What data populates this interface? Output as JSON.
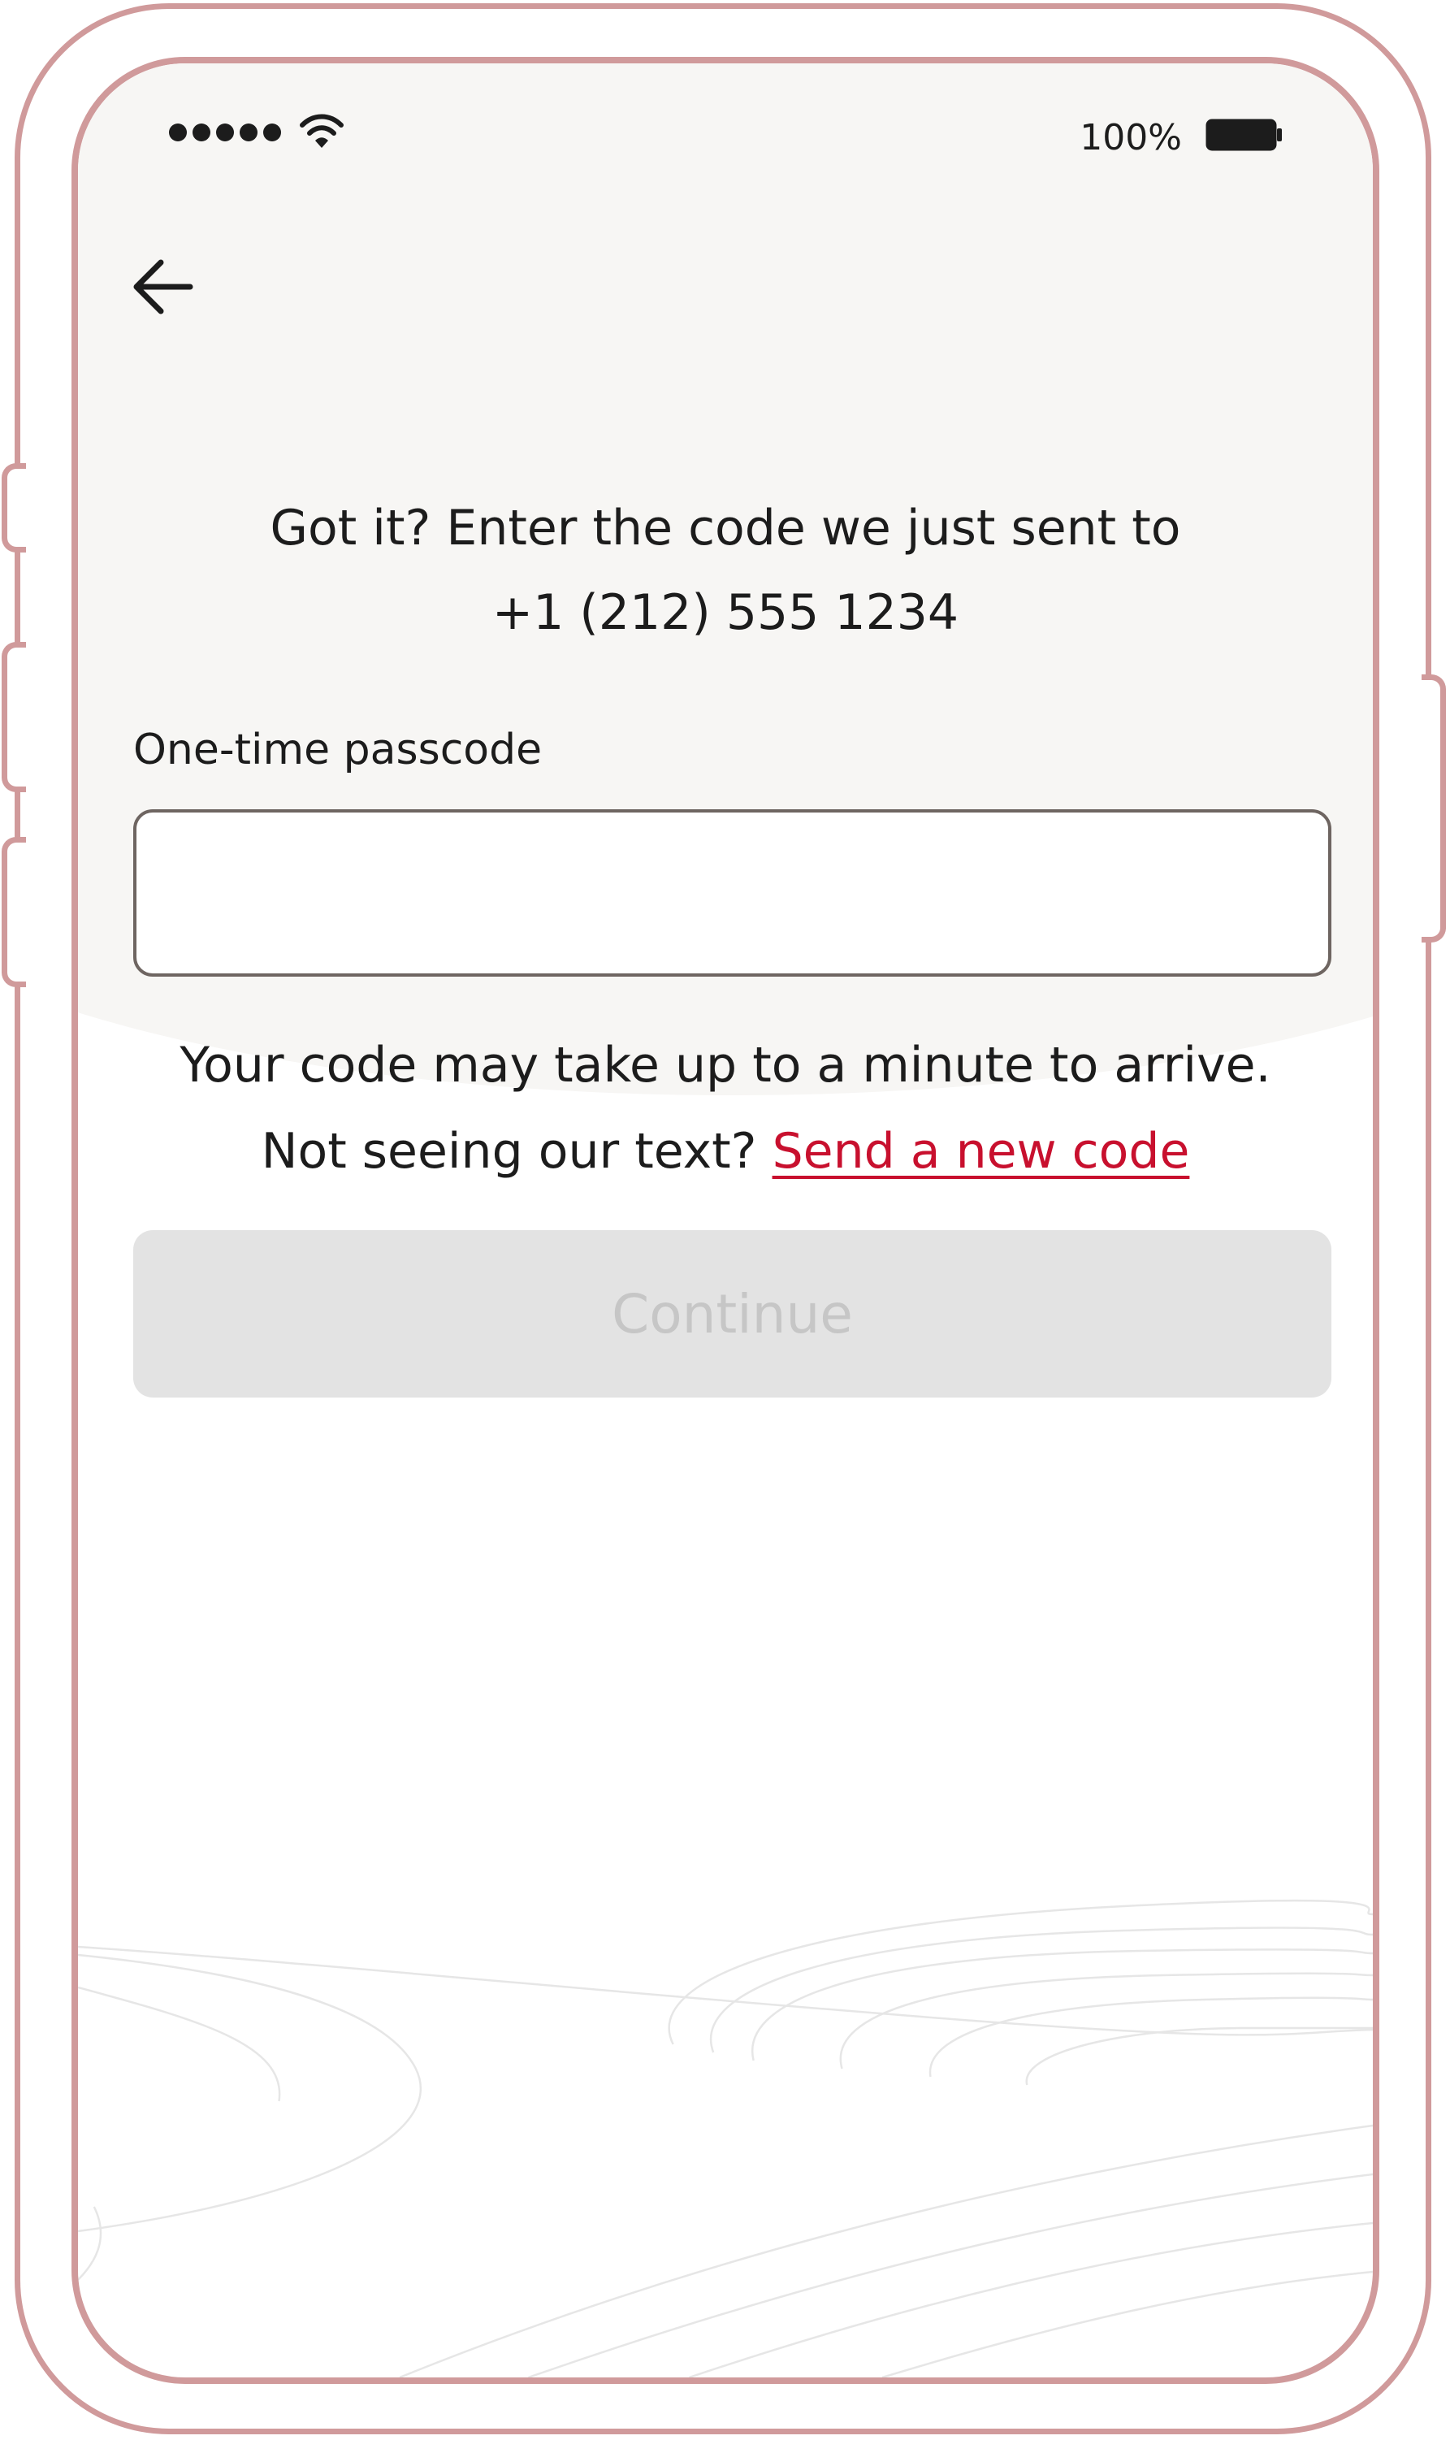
{
  "status_bar": {
    "battery_percent": "100%",
    "signal_icon": "signal-dots-icon",
    "wifi_icon": "wifi-icon",
    "battery_icon": "battery-icon"
  },
  "nav": {
    "back_icon": "arrow-left-icon"
  },
  "heading": {
    "line1": "Got it? Enter the code we just sent to",
    "line2": "+1 (212) 555 1234"
  },
  "otp_field": {
    "label": "One-time passcode",
    "value": "",
    "placeholder": ""
  },
  "helper": {
    "line1": "Your code may take up to a minute to arrive.",
    "line2_prefix": "Not seeing our text?",
    "resend_link": "Send a new code"
  },
  "continue_button": {
    "label": "Continue",
    "enabled": false
  },
  "colors": {
    "frame": "#d09a9b",
    "background_top": "#f7f6f4",
    "text": "#1c1c1c",
    "link": "#c8102e",
    "button_disabled_bg": "#e3e3e3",
    "button_disabled_text": "#c6c6c6",
    "input_border": "#6e6561"
  }
}
